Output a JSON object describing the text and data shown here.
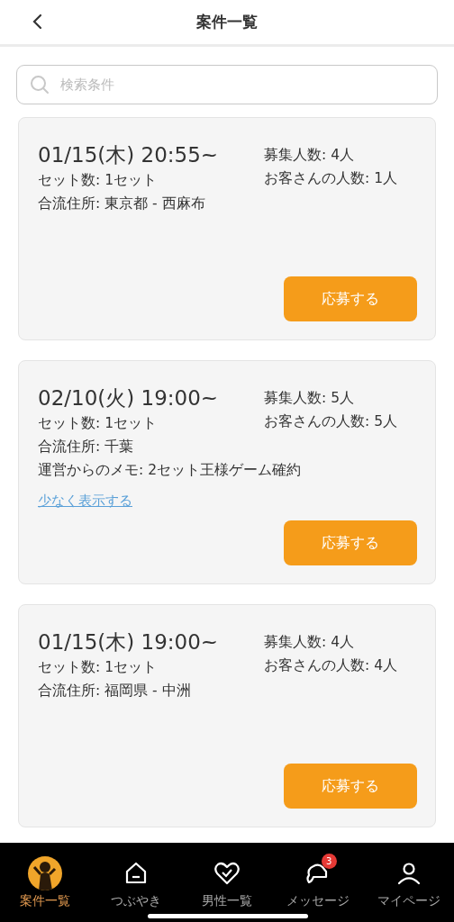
{
  "header": {
    "title": "案件一覧"
  },
  "search": {
    "placeholder": "検索条件"
  },
  "cards": [
    {
      "datetime": "01/15(木) 20:55~",
      "sets": "セット数: 1セット",
      "address": "合流住所: 東京都 - 西麻布",
      "recruit": "募集人数: 4人",
      "guests": "お客さんの人数: 1人",
      "button": "応募する"
    },
    {
      "datetime": "02/10(火) 19:00~",
      "sets": "セット数: 1セット",
      "address": "合流住所: 千葉",
      "memo": "運営からのメモ: 2セット王様ゲーム確約",
      "toggle_link": "少なく表示する",
      "recruit": "募集人数: 5人",
      "guests": "お客さんの人数: 5人",
      "button": "応募する"
    },
    {
      "datetime": "01/15(木) 19:00~",
      "sets": "セット数: 1セット",
      "address": "合流住所: 福岡県 - 中洲",
      "recruit": "募集人数: 4人",
      "guests": "お客さんの人数: 4人",
      "button": "応募する"
    }
  ],
  "tab_bar": [
    {
      "kind": "avatar",
      "label": "案件一覧",
      "selected": true
    },
    {
      "kind": "home",
      "label": "つぶやき",
      "selected": false
    },
    {
      "kind": "heart",
      "label": "男性一覧",
      "selected": false
    },
    {
      "kind": "chat",
      "label": "メッセージ",
      "selected": false,
      "badge": "3"
    },
    {
      "kind": "person",
      "label": "マイページ",
      "selected": false
    }
  ]
}
